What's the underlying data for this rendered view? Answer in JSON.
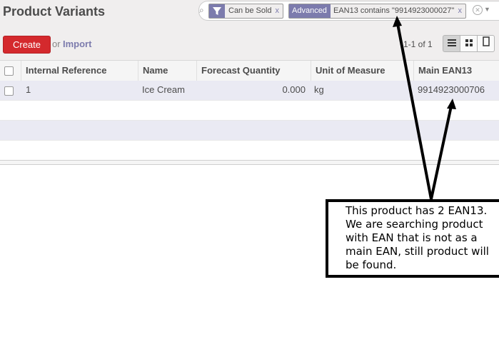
{
  "page": {
    "title": "Product Variants"
  },
  "search": {
    "facets": [
      {
        "label": "",
        "value": "Can be Sold",
        "remove": "x"
      },
      {
        "label": "Advanced",
        "value": "EAN13 contains \"9914923000027\"",
        "remove": "x"
      }
    ]
  },
  "toolbar": {
    "create_label": "Create",
    "or_label": "or",
    "import_label": "Import"
  },
  "pager": {
    "text": "1-1 of 1"
  },
  "table": {
    "columns": [
      "Internal Reference",
      "Name",
      "Forecast Quantity",
      "Unit of Measure",
      "Main EAN13"
    ],
    "rows": [
      {
        "internal_reference": "1",
        "name": "Ice Cream",
        "forecast_quantity": "0.000",
        "uom": "kg",
        "main_ean13": "9914923000706"
      }
    ]
  },
  "annotation": {
    "text": "This product has 2 EAN13.\nWe are searching product\nwith EAN that is not as a\nmain EAN, still product will\nbe found."
  },
  "colors": {
    "create": "#d4292d",
    "facet_label": "#7c7bad",
    "selected_row": "#eaeaf3"
  }
}
